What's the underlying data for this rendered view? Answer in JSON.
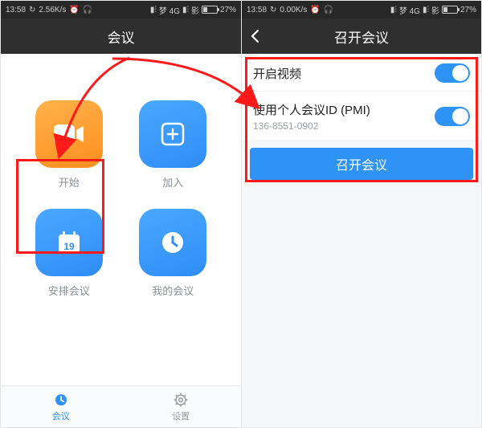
{
  "left": {
    "status": {
      "time": "13:58",
      "net_speed": "2.56K/s",
      "carrier": "梦 4G",
      "carrier2": "影",
      "battery_pct": "27%"
    },
    "header": {
      "title": "会议"
    },
    "tiles": {
      "start": "开始",
      "join": "加入",
      "schedule": "安排会议",
      "mine": "我的会议"
    },
    "tabs": {
      "meeting": "会议",
      "settings": "设置"
    }
  },
  "right": {
    "status": {
      "time": "13:58",
      "net_speed": "0.00K/s",
      "carrier": "梦 4G",
      "carrier2": "影",
      "battery_pct": "27%"
    },
    "header": {
      "title": "召开会议"
    },
    "options": {
      "enable_video": "开启视频",
      "use_pmi": "使用个人会议ID (PMI)",
      "pmi_value": "136-8551-0902"
    },
    "primary_btn": "召开会议"
  }
}
